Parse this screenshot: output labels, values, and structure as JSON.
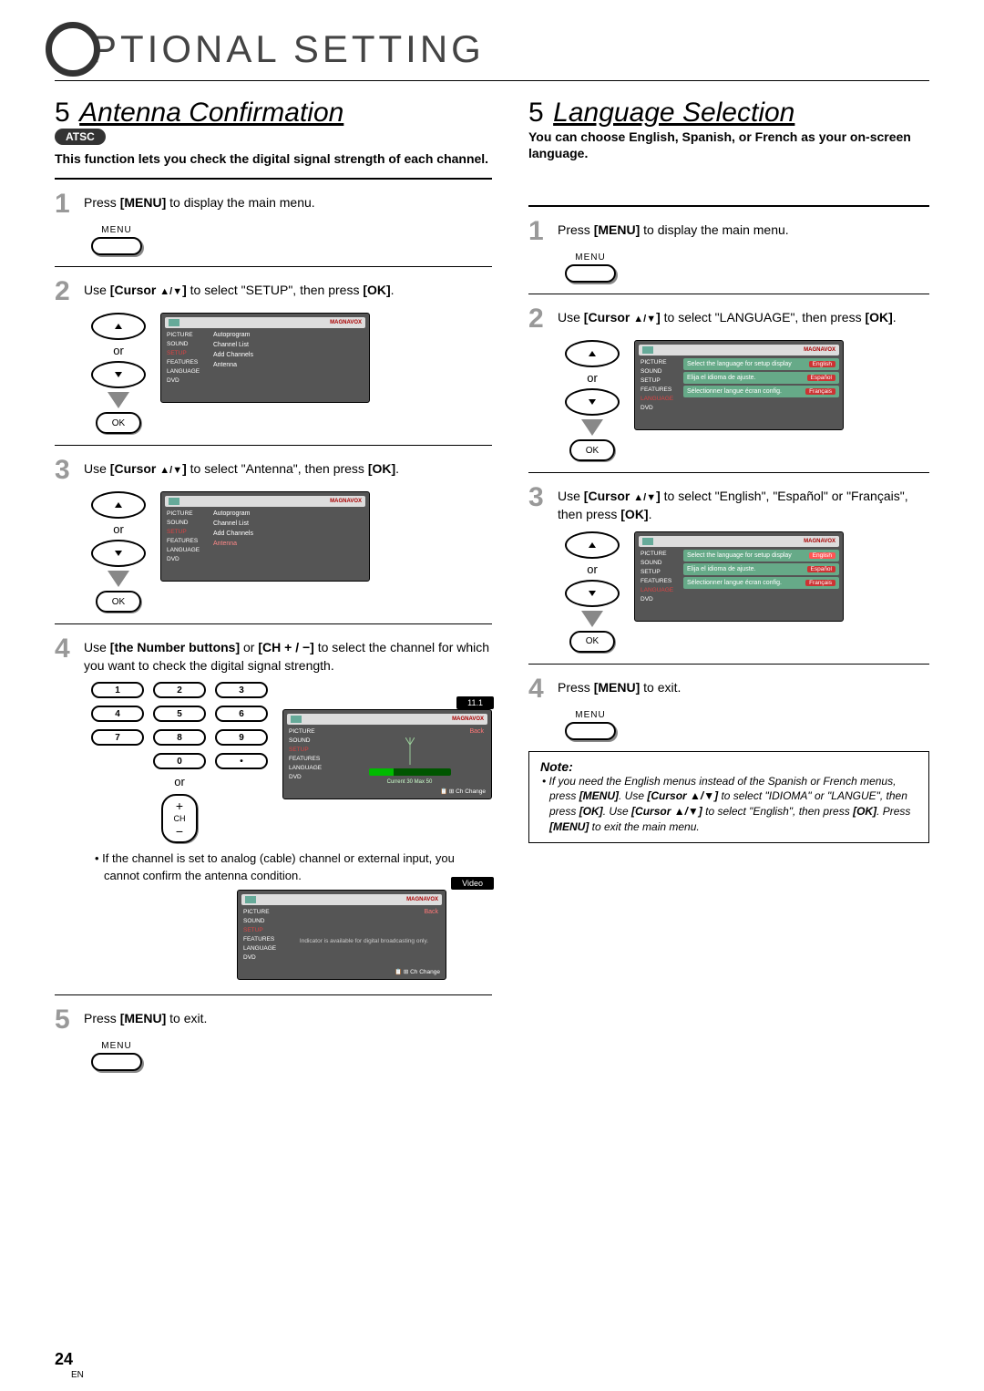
{
  "page_title": "PTIONAL SETTING",
  "left": {
    "section_num": "5",
    "section_title": "Antenna Confirmation",
    "atsc_badge": "ATSC",
    "desc": "This function lets you check the digital signal strength of each channel.",
    "step1": "Press [MENU] to display the main menu.",
    "menu_label": "MENU",
    "step2": "Use [Cursor ▲/▼] to select \"SETUP\", then press [OK].",
    "or": "or",
    "ok": "OK",
    "sidebar_items": [
      "PICTURE",
      "SOUND",
      "SETUP",
      "FEATURES",
      "LANGUAGE",
      "DVD"
    ],
    "setup_options": [
      "Autoprogram",
      "Channel List",
      "Add Channels",
      "Antenna"
    ],
    "brand": "MAGNAVOX",
    "step3": "Use [Cursor ▲/▼] to select \"Antenna\", then press [OK].",
    "step4": "Use [the Number buttons] or [CH + / −] to select the channel for which you want to check the digital signal strength.",
    "keypad": [
      "1",
      "2",
      "3",
      "4",
      "5",
      "6",
      "7",
      "8",
      "9",
      "",
      "0",
      "•"
    ],
    "ch_label": "CH",
    "channel_badge": "11.1",
    "antenna_reading": "Current  30  Max       50",
    "ch_change": "Ch Change",
    "back": "Back",
    "bullet1": "If the channel is set to analog (cable) channel or external input, you cannot confirm the antenna condition.",
    "video_badge": "Video",
    "video_msg": "Indicator is available for digital broadcasting only.",
    "step5": "Press [MENU] to exit."
  },
  "right": {
    "section_num": "5",
    "section_title": "Language Selection",
    "desc": "You can choose English, Spanish, or French as your on-screen language.",
    "step1": "Press [MENU] to display the main menu.",
    "menu_label": "MENU",
    "step2": "Use [Cursor ▲/▼] to select \"LANGUAGE\", then press [OK].",
    "or": "or",
    "ok": "OK",
    "sidebar_items": [
      "PICTURE",
      "SOUND",
      "SETUP",
      "FEATURES",
      "LANGUAGE",
      "DVD"
    ],
    "lang_rows": [
      {
        "text": "Select the language for setup display",
        "btn": "English"
      },
      {
        "text": "Elija el idioma de ajuste.",
        "btn": "Español"
      },
      {
        "text": "Sélectionner langue écran config.",
        "btn": "Français"
      }
    ],
    "brand": "MAGNAVOX",
    "step3": "Use [Cursor ▲/▼] to select \"English\", \"Español\" or \"Français\", then press [OK].",
    "step4": "Press [MENU] to exit.",
    "note_title": "Note:",
    "note_text": "If you need the English menus instead of the Spanish or French menus, press [MENU]. Use [Cursor ▲/▼] to select \"IDIOMA\" or \"LANGUE\", then press [OK]. Use [Cursor ▲/▼] to select \"English\", then press [OK]. Press [MENU] to exit the main menu."
  },
  "page_number": "24",
  "page_lang": "EN"
}
